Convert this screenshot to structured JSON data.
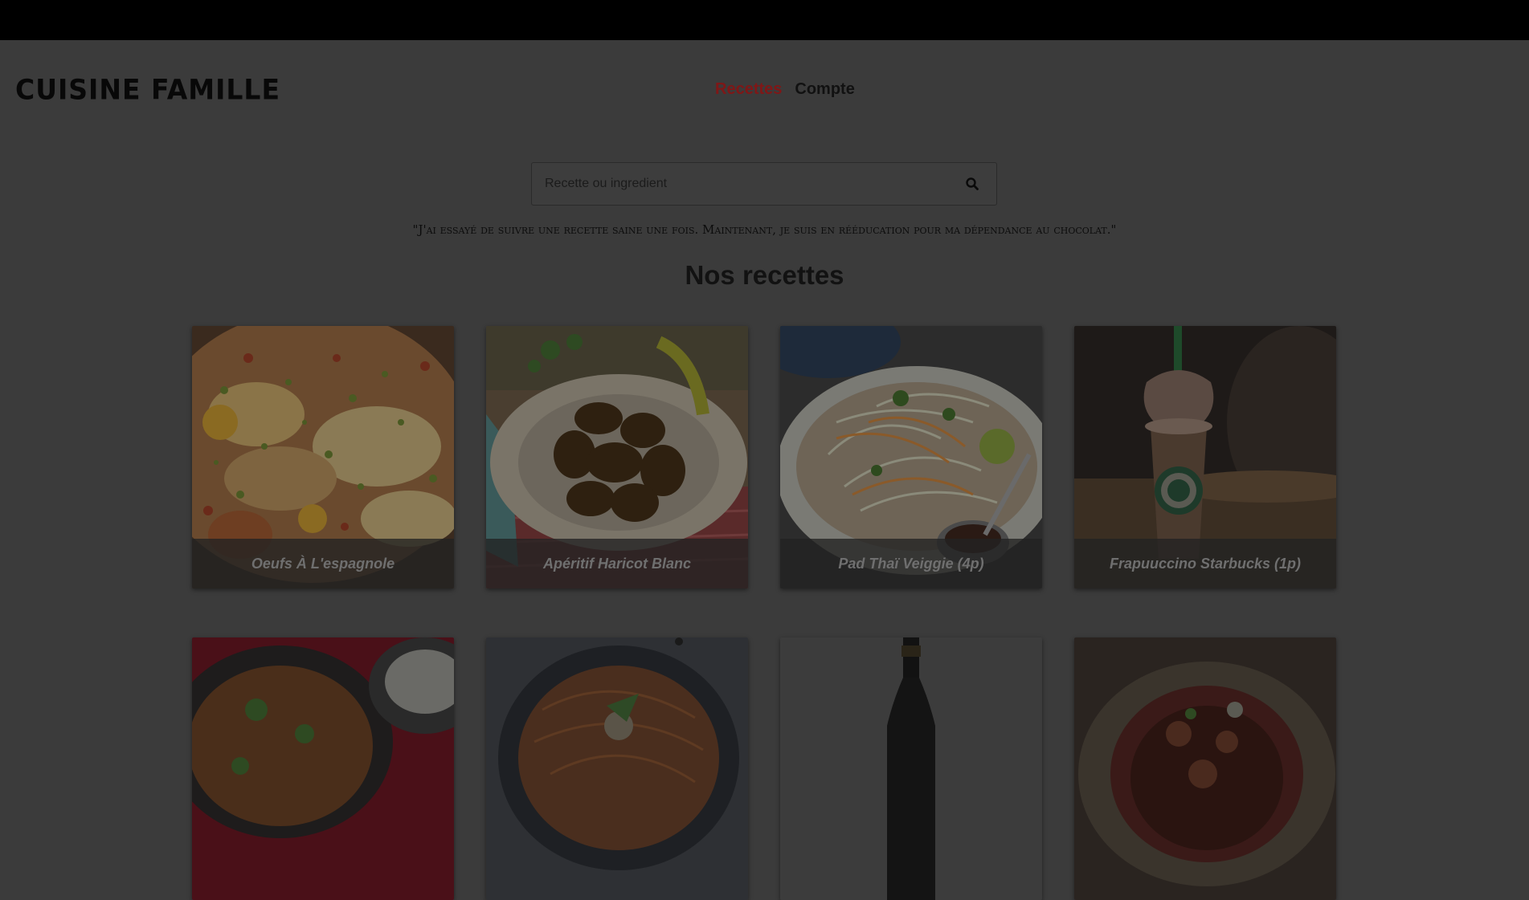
{
  "header": {
    "logo": "CUISINE FAMILLE",
    "nav": [
      {
        "label": "Recettes",
        "active": true
      },
      {
        "label": "Compte",
        "active": false
      }
    ]
  },
  "search": {
    "placeholder": "Recette ou ingredient",
    "icon": "search-icon"
  },
  "quote": "\"J'ai essayé de suivre une recette saine une fois. Maintenant, je suis en rééducation pour ma dépendance au chocolat.\"",
  "section_title": "Nos recettes",
  "recipes": [
    {
      "title": "Oeufs À L'espagnole"
    },
    {
      "title": "Apéritif Haricot Blanc"
    },
    {
      "title": "Pad Thaï Veiggie (4p)"
    },
    {
      "title": "Frapuuccino Starbucks (1p)"
    }
  ],
  "colors": {
    "overlay_background": "#3b3b3b",
    "top_bar": "#000000",
    "active_nav": "#7f1717"
  }
}
